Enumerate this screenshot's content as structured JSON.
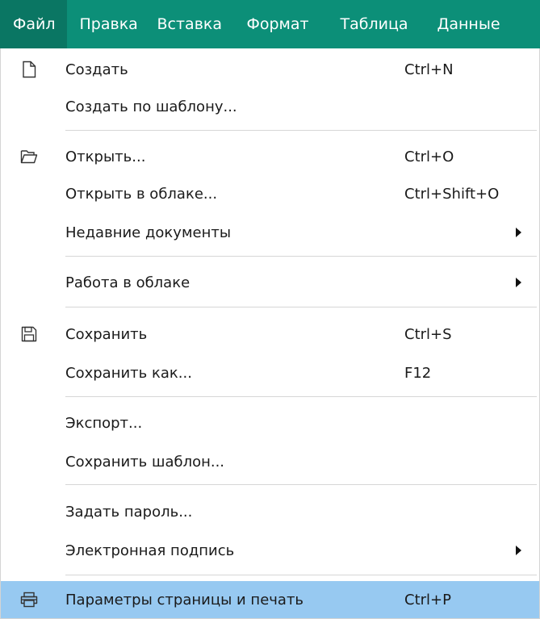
{
  "menubar": {
    "items": [
      {
        "label": "Файл",
        "active": true
      },
      {
        "label": "Правка"
      },
      {
        "label": "Вставка"
      },
      {
        "label": "Формат"
      },
      {
        "label": "Таблица"
      },
      {
        "label": "Данные"
      }
    ],
    "colors": {
      "background": "#0c8f78",
      "active": "#0a7663",
      "text": "#ffffff"
    }
  },
  "file_menu": {
    "highlight_color": "#97c9f1",
    "items": [
      {
        "label": "Создать",
        "shortcut": "Ctrl+N",
        "icon": "new-document-icon"
      },
      {
        "label": "Создать по шаблону..."
      },
      {
        "label": "Открыть...",
        "shortcut": "Ctrl+O",
        "icon": "open-folder-icon"
      },
      {
        "label": "Открыть в облаке...",
        "shortcut": "Ctrl+Shift+O"
      },
      {
        "label": "Недавние документы",
        "submenu": true
      },
      {
        "label": "Работа в облаке",
        "submenu": true
      },
      {
        "label": "Сохранить",
        "shortcut": "Ctrl+S",
        "icon": "save-floppy-icon"
      },
      {
        "label": "Сохранить как...",
        "shortcut": "F12"
      },
      {
        "label": "Экспорт..."
      },
      {
        "label": "Сохранить шаблон..."
      },
      {
        "label": "Задать пароль..."
      },
      {
        "label": "Электронная подпись",
        "submenu": true
      },
      {
        "label": "Параметры страницы и печать",
        "shortcut": "Ctrl+P",
        "icon": "printer-icon",
        "highlighted": true
      }
    ]
  }
}
